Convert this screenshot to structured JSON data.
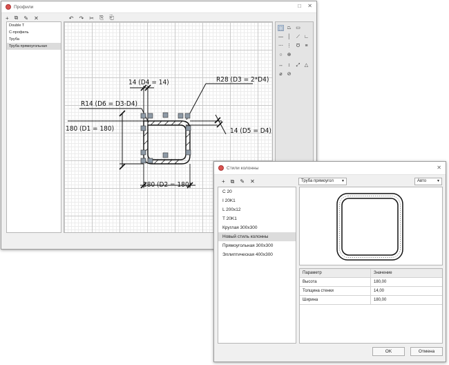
{
  "profiles_window": {
    "title": "Профили",
    "toolbar": [
      "+",
      "⧉",
      "✎",
      "✕",
      "↶",
      "↷",
      "✂",
      "⎘",
      "⎗"
    ],
    "list": [
      "Double T",
      "С-профиль",
      "Труба",
      "Труба прямоугольная"
    ],
    "selected_index": 3,
    "annotations": {
      "d4": "14 (D4 = 14)",
      "d3": "R28 (D3 = 2*D4)",
      "d6": "R14 (D6 = D3-D4)",
      "d1": "180 (D1 = 180)",
      "d5": "14 (D5 = D4)",
      "d2": "180 (D2 = 180)"
    },
    "tools": [
      "⬚",
      "⏢",
      "▭",
      "—",
      "│",
      "⟋",
      "∟",
      "⋯",
      "⋮",
      "Ʊ",
      "≡",
      "○",
      "⊕",
      "↔",
      "↕",
      "⤢",
      "△",
      "⌀",
      "⊘"
    ]
  },
  "column_styles_dialog": {
    "title": "Стили колонны",
    "toolbar": [
      "+",
      "⧉",
      "✎",
      "✕"
    ],
    "list": [
      "C 20",
      "I 20K1",
      "L 200x12",
      "T 20K1",
      "Круглая 300x300",
      "Новый стиль колонны",
      "Прямоугольная 300x300",
      "Эллиптическая 400x300"
    ],
    "selected_index": 5,
    "profile_dropdown": "Труба прямоугол",
    "scale_dropdown": "Авто",
    "table": {
      "headers": [
        "Параметр",
        "Значение"
      ],
      "rows": [
        {
          "param": "Высота",
          "value": "180,00"
        },
        {
          "param": "Толщина стенки",
          "value": "14,00"
        },
        {
          "param": "Ширина",
          "value": "180,00"
        }
      ]
    },
    "ok_label": "OK",
    "cancel_label": "Отмена",
    "accent_color": "#d9534f"
  }
}
